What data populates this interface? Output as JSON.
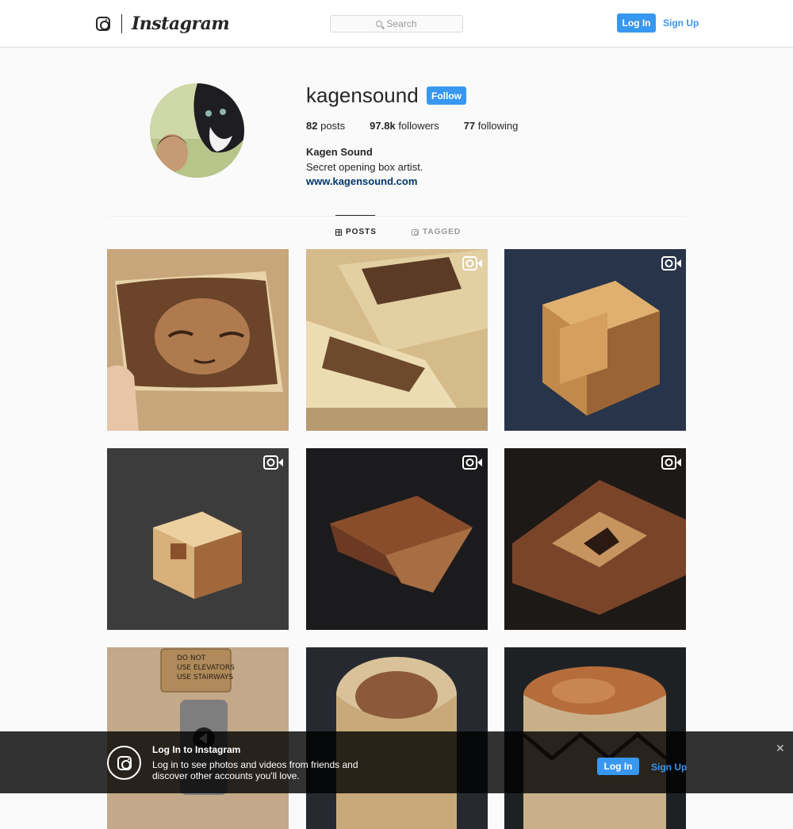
{
  "header": {
    "logo_text": "Instagram",
    "search_placeholder": "Search",
    "login_label": "Log In",
    "signup_label": "Sign Up"
  },
  "profile": {
    "username": "kagensound",
    "follow_label": "Follow",
    "stats": [
      {
        "count": "82",
        "label": "posts"
      },
      {
        "count": "97.8k",
        "label": "followers"
      },
      {
        "count": "77",
        "label": "following"
      }
    ],
    "full_name": "Kagen Sound",
    "bio": "Secret opening box artist.",
    "website": "www.kagensound.com"
  },
  "tabs": [
    {
      "label": "POSTS",
      "active": true,
      "icon": "grid-icon"
    },
    {
      "label": "TAGGED",
      "active": false,
      "icon": "tagged-icon"
    }
  ],
  "posts": [
    {
      "subject": "inlaid face portrait panel",
      "is_video": false
    },
    {
      "subject": "boxes with face inlay on workbench",
      "is_video": true
    },
    {
      "subject": "light wood puzzle cube",
      "is_video": true
    },
    {
      "subject": "small puzzle cube",
      "is_video": true
    },
    {
      "subject": "walnut box",
      "is_video": true
    },
    {
      "subject": "square frame box with triangle inlay",
      "is_video": true
    },
    {
      "subject": "elevator button with sign",
      "is_video": false,
      "sign_text": [
        "DO NOT",
        "USE ELEVATORS",
        "USE STAIRWAYS"
      ]
    },
    {
      "subject": "round open wooden box",
      "is_video": false
    },
    {
      "subject": "round burl lid box",
      "is_video": false
    }
  ],
  "banner": {
    "title": "Log In to Instagram",
    "text": "Log in to see photos and videos from friends and discover other accounts you'll love.",
    "login_label": "Log In",
    "signup_label": "Sign Up",
    "close_glyph": "✕"
  },
  "colors": {
    "accent": "#3897f0",
    "link": "#003569",
    "background": "#fafafa",
    "text": "#262626"
  }
}
